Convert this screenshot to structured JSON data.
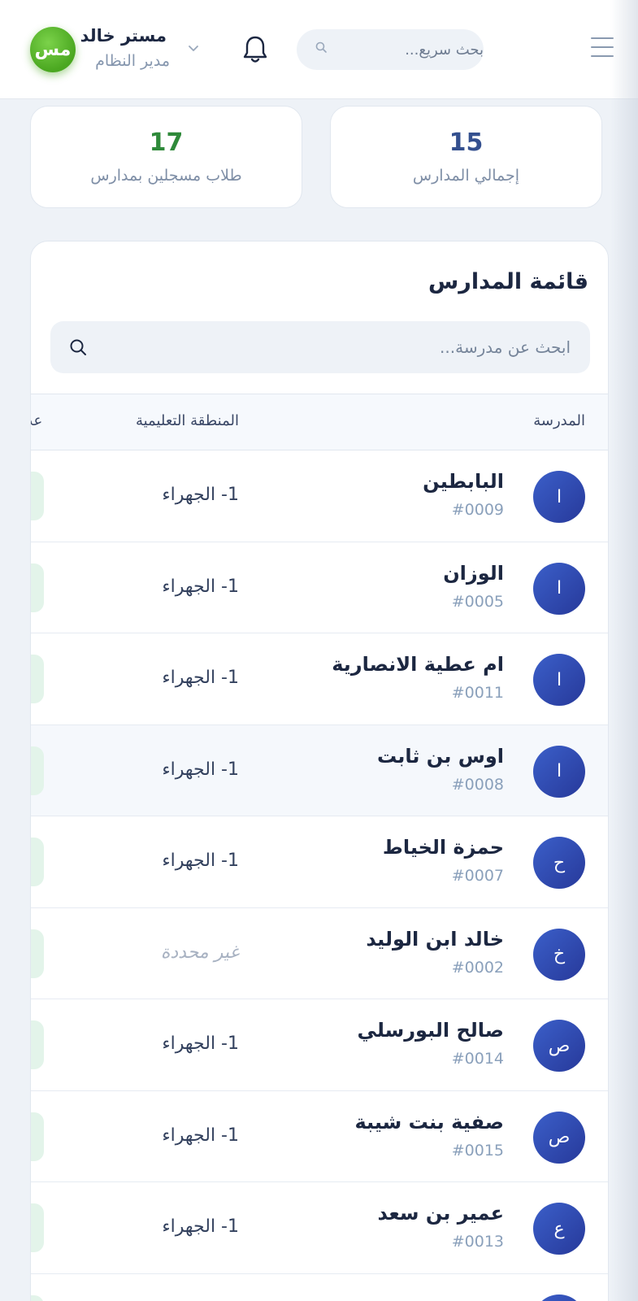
{
  "header": {
    "quick_search_placeholder": "بحث سريع...",
    "user_name": "مستر خالد",
    "user_role": "مدير النظام",
    "avatar_initials": "مس"
  },
  "stats": [
    {
      "value": "15",
      "label": "إجمالي المدارس"
    },
    {
      "value": "17",
      "label": "طلاب مسجلين بمدارس"
    }
  ],
  "panel": {
    "title": "قائمة المدارس",
    "search_placeholder": "ابحث عن مدرسة..."
  },
  "table": {
    "columns": [
      "المدرسة",
      "المنطقة التعليمية",
      "عد"
    ],
    "rows": [
      {
        "initial": "ا",
        "name": "البابطين",
        "code": "#0009",
        "region": "1- الجهراء"
      },
      {
        "initial": "ا",
        "name": "الوزان",
        "code": "#0005",
        "region": "1- الجهراء"
      },
      {
        "initial": "ا",
        "name": "ام عطية الانصارية",
        "code": "#0011",
        "region": "1- الجهراء"
      },
      {
        "initial": "ا",
        "name": "اوس بن ثابت",
        "code": "#0008",
        "region": "1- الجهراء"
      },
      {
        "initial": "ح",
        "name": "حمزة الخياط",
        "code": "#0007",
        "region": "1- الجهراء"
      },
      {
        "initial": "خ",
        "name": "خالد ابن الوليد",
        "code": "#0002",
        "region": "غير محددة"
      },
      {
        "initial": "ص",
        "name": "صالح البورسلي",
        "code": "#0014",
        "region": "1- الجهراء"
      },
      {
        "initial": "ص",
        "name": "صفية بنت شيبة",
        "code": "#0015",
        "region": "1- الجهراء"
      },
      {
        "initial": "ع",
        "name": "عمير بن سعد",
        "code": "#0013",
        "region": "1- الجهراء"
      }
    ]
  },
  "colors": {
    "accent_blue": "#34508f",
    "accent_green": "#2f8a3a",
    "avatar_green": "#4aa720",
    "row_avatar": "#2f45ae"
  }
}
